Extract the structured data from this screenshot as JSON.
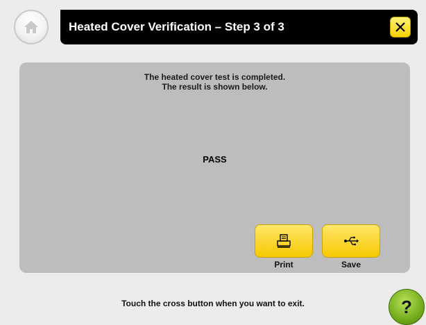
{
  "header": {
    "title": "Heated Cover Verification – Step 3 of 3",
    "home_icon": "home-icon",
    "close_icon": "close-icon"
  },
  "panel": {
    "message_line1": "The heated cover test is completed.",
    "message_line2": "The result is shown below.",
    "result": "PASS"
  },
  "actions": {
    "print_label": "Print",
    "print_icon": "printer-icon",
    "save_label": "Save",
    "save_icon": "usb-icon"
  },
  "footer": {
    "instruction": "Touch the cross button when you want to exit.",
    "help_label": "?"
  },
  "colors": {
    "accent_yellow": "#f6d200",
    "panel_gray": "#bdbdbd",
    "help_green": "#74ad1d"
  }
}
